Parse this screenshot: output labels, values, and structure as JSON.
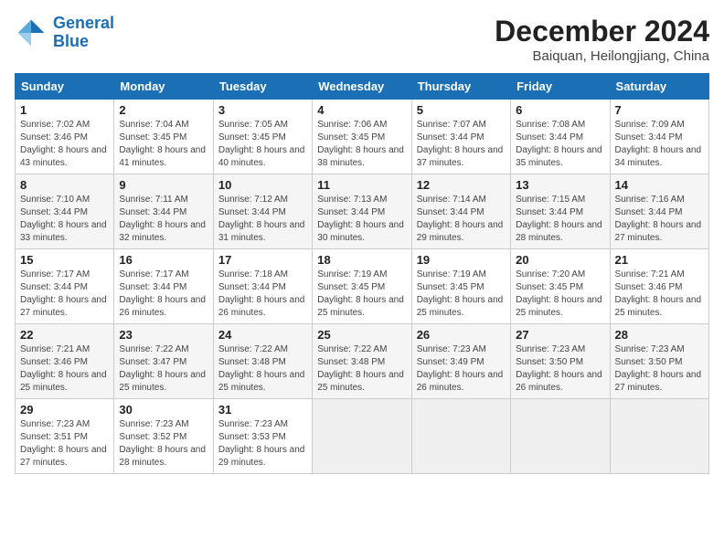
{
  "logo": {
    "line1": "General",
    "line2": "Blue"
  },
  "title": "December 2024",
  "location": "Baiquan, Heilongjiang, China",
  "weekdays": [
    "Sunday",
    "Monday",
    "Tuesday",
    "Wednesday",
    "Thursday",
    "Friday",
    "Saturday"
  ],
  "weeks": [
    [
      {
        "day": "1",
        "sunrise": "7:02 AM",
        "sunset": "3:46 PM",
        "daylight": "8 hours and 43 minutes."
      },
      {
        "day": "2",
        "sunrise": "7:04 AM",
        "sunset": "3:45 PM",
        "daylight": "8 hours and 41 minutes."
      },
      {
        "day": "3",
        "sunrise": "7:05 AM",
        "sunset": "3:45 PM",
        "daylight": "8 hours and 40 minutes."
      },
      {
        "day": "4",
        "sunrise": "7:06 AM",
        "sunset": "3:45 PM",
        "daylight": "8 hours and 38 minutes."
      },
      {
        "day": "5",
        "sunrise": "7:07 AM",
        "sunset": "3:44 PM",
        "daylight": "8 hours and 37 minutes."
      },
      {
        "day": "6",
        "sunrise": "7:08 AM",
        "sunset": "3:44 PM",
        "daylight": "8 hours and 35 minutes."
      },
      {
        "day": "7",
        "sunrise": "7:09 AM",
        "sunset": "3:44 PM",
        "daylight": "8 hours and 34 minutes."
      }
    ],
    [
      {
        "day": "8",
        "sunrise": "7:10 AM",
        "sunset": "3:44 PM",
        "daylight": "8 hours and 33 minutes."
      },
      {
        "day": "9",
        "sunrise": "7:11 AM",
        "sunset": "3:44 PM",
        "daylight": "8 hours and 32 minutes."
      },
      {
        "day": "10",
        "sunrise": "7:12 AM",
        "sunset": "3:44 PM",
        "daylight": "8 hours and 31 minutes."
      },
      {
        "day": "11",
        "sunrise": "7:13 AM",
        "sunset": "3:44 PM",
        "daylight": "8 hours and 30 minutes."
      },
      {
        "day": "12",
        "sunrise": "7:14 AM",
        "sunset": "3:44 PM",
        "daylight": "8 hours and 29 minutes."
      },
      {
        "day": "13",
        "sunrise": "7:15 AM",
        "sunset": "3:44 PM",
        "daylight": "8 hours and 28 minutes."
      },
      {
        "day": "14",
        "sunrise": "7:16 AM",
        "sunset": "3:44 PM",
        "daylight": "8 hours and 27 minutes."
      }
    ],
    [
      {
        "day": "15",
        "sunrise": "7:17 AM",
        "sunset": "3:44 PM",
        "daylight": "8 hours and 27 minutes."
      },
      {
        "day": "16",
        "sunrise": "7:17 AM",
        "sunset": "3:44 PM",
        "daylight": "8 hours and 26 minutes."
      },
      {
        "day": "17",
        "sunrise": "7:18 AM",
        "sunset": "3:44 PM",
        "daylight": "8 hours and 26 minutes."
      },
      {
        "day": "18",
        "sunrise": "7:19 AM",
        "sunset": "3:45 PM",
        "daylight": "8 hours and 25 minutes."
      },
      {
        "day": "19",
        "sunrise": "7:19 AM",
        "sunset": "3:45 PM",
        "daylight": "8 hours and 25 minutes."
      },
      {
        "day": "20",
        "sunrise": "7:20 AM",
        "sunset": "3:45 PM",
        "daylight": "8 hours and 25 minutes."
      },
      {
        "day": "21",
        "sunrise": "7:21 AM",
        "sunset": "3:46 PM",
        "daylight": "8 hours and 25 minutes."
      }
    ],
    [
      {
        "day": "22",
        "sunrise": "7:21 AM",
        "sunset": "3:46 PM",
        "daylight": "8 hours and 25 minutes."
      },
      {
        "day": "23",
        "sunrise": "7:22 AM",
        "sunset": "3:47 PM",
        "daylight": "8 hours and 25 minutes."
      },
      {
        "day": "24",
        "sunrise": "7:22 AM",
        "sunset": "3:48 PM",
        "daylight": "8 hours and 25 minutes."
      },
      {
        "day": "25",
        "sunrise": "7:22 AM",
        "sunset": "3:48 PM",
        "daylight": "8 hours and 25 minutes."
      },
      {
        "day": "26",
        "sunrise": "7:23 AM",
        "sunset": "3:49 PM",
        "daylight": "8 hours and 26 minutes."
      },
      {
        "day": "27",
        "sunrise": "7:23 AM",
        "sunset": "3:50 PM",
        "daylight": "8 hours and 26 minutes."
      },
      {
        "day": "28",
        "sunrise": "7:23 AM",
        "sunset": "3:50 PM",
        "daylight": "8 hours and 27 minutes."
      }
    ],
    [
      {
        "day": "29",
        "sunrise": "7:23 AM",
        "sunset": "3:51 PM",
        "daylight": "8 hours and 27 minutes."
      },
      {
        "day": "30",
        "sunrise": "7:23 AM",
        "sunset": "3:52 PM",
        "daylight": "8 hours and 28 minutes."
      },
      {
        "day": "31",
        "sunrise": "7:23 AM",
        "sunset": "3:53 PM",
        "daylight": "8 hours and 29 minutes."
      },
      null,
      null,
      null,
      null
    ]
  ]
}
